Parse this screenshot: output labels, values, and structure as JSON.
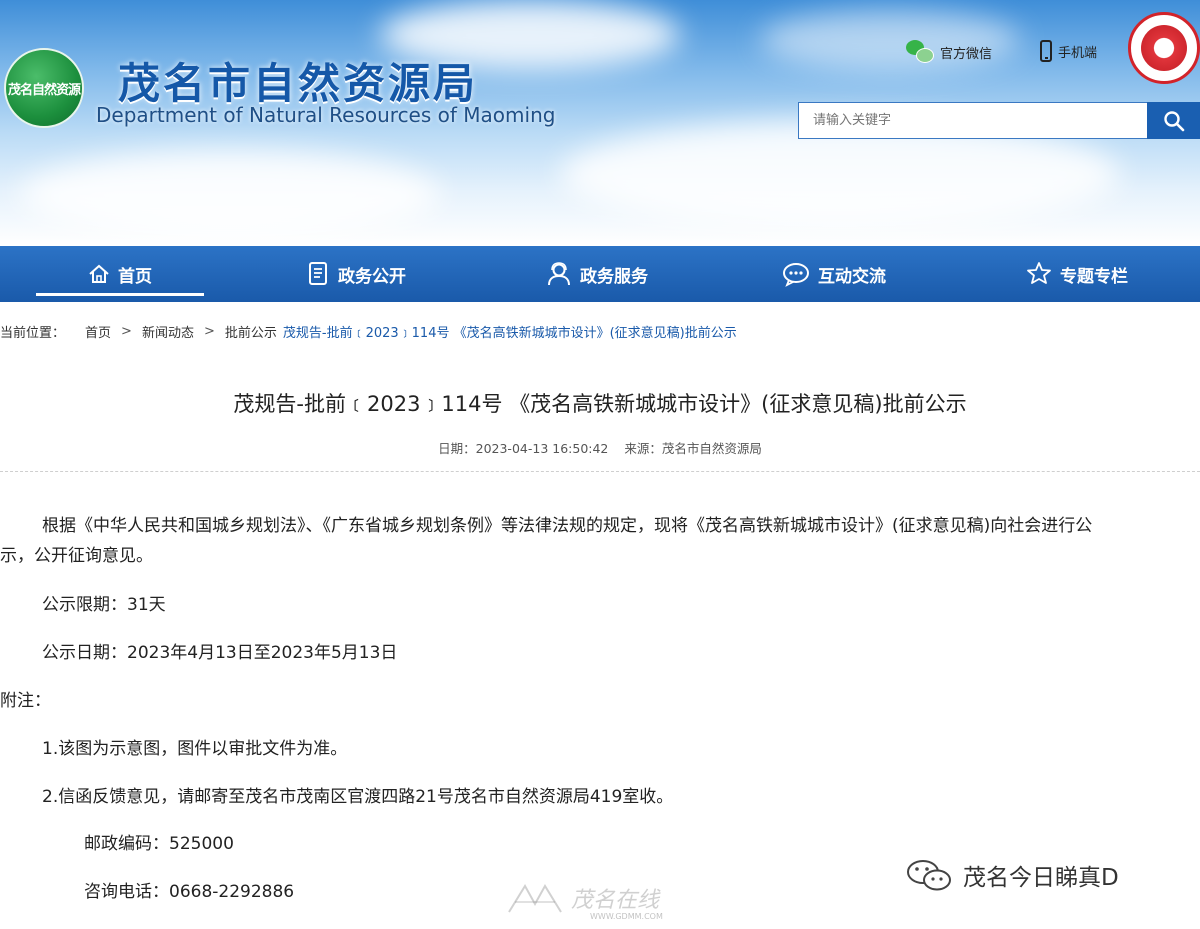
{
  "header": {
    "logo_text": "茂名自然资源",
    "title": "茂名市自然资源局",
    "subtitle": "Department of Natural Resources of Maoming",
    "links": [
      {
        "label": "官方微信",
        "icon": "wechat-icon"
      },
      {
        "label": "手机端",
        "icon": "phone-icon"
      }
    ],
    "emblem_icon": "emblem-icon",
    "search_placeholder": "请输入关键字"
  },
  "nav": {
    "items": [
      {
        "label": "首页",
        "icon": "home-icon",
        "active": true
      },
      {
        "label": "政务公开",
        "icon": "document-icon"
      },
      {
        "label": "政务服务",
        "icon": "service-icon"
      },
      {
        "label": "互动交流",
        "icon": "chat-icon"
      },
      {
        "label": "专题专栏",
        "icon": "topic-icon"
      }
    ]
  },
  "breadcrumb": {
    "prefix": "当前位置：",
    "items": [
      "首页",
      "新闻动态",
      "批前公示"
    ],
    "separator": ">",
    "current": "茂规告-批前﹝2023﹞114号 《茂名高铁新城城市设计》(征求意见稿)批前公示"
  },
  "article": {
    "title": "茂规告-批前﹝2023﹞114号 《茂名高铁新城城市设计》(征求意见稿)批前公示",
    "date_label": "日期：",
    "date": "2023-04-13 16:50:42",
    "source_label": "来源：",
    "source": "茂名市自然资源局",
    "para1_line1": "根据《中华人民共和国城乡规划法》、《广东省城乡规划条例》等法律法规的规定，现将《茂名高铁新城城市设计》(征求意见稿)向社会进行公",
    "para1_line2": "示，公开征询意见。",
    "period": "公示限期：31天",
    "dates": "公示日期：2023年4月13日至2023年5月13日",
    "note_heading": "附注：",
    "note1": "1.该图为示意图，图件以审批文件为准。",
    "note2": "2.信函反馈意见，请邮寄至茂名市茂南区官渡四路21号茂名市自然资源局419室收。",
    "postcode": "邮政编码：525000",
    "phone": "咨询电话：0668-2292886"
  },
  "watermarks": {
    "center": "茂名在线",
    "center_url": "WWW.GDMM.COM",
    "right": "茂名今日睇真D"
  },
  "colors": {
    "brand_blue": "#1a5aaa",
    "title_blue": "#1558a8",
    "green": "#1c8f3d",
    "red": "#d2232a"
  }
}
